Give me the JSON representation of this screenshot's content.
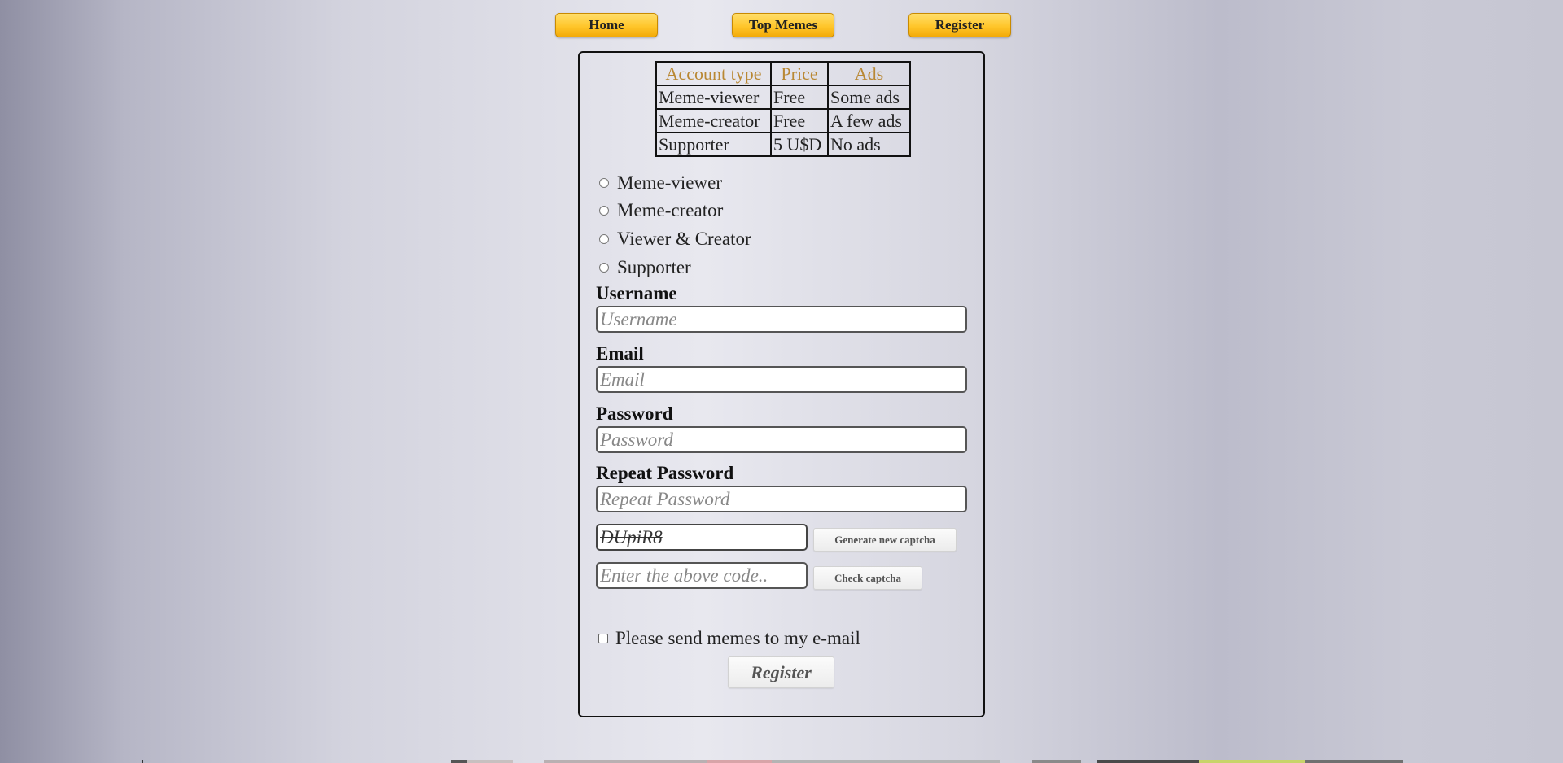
{
  "nav": {
    "home": "Home",
    "top_memes": "Top Memes",
    "register": "Register"
  },
  "account_table": {
    "headers": [
      "Account type",
      "Price",
      "Ads"
    ],
    "rows": [
      [
        "Meme-viewer",
        "Free",
        "Some ads"
      ],
      [
        "Meme-creator",
        "Free",
        "A few ads"
      ],
      [
        "Supporter",
        "5 U$D",
        "No ads"
      ]
    ]
  },
  "account_options": [
    "Meme-viewer",
    "Meme-creator",
    "Viewer & Creator",
    "Supporter"
  ],
  "form": {
    "username": {
      "label": "Username",
      "placeholder": "Username"
    },
    "email": {
      "label": "Email",
      "placeholder": "Email"
    },
    "password": {
      "label": "Password",
      "placeholder": "Password"
    },
    "repeat_password": {
      "label": "Repeat Password",
      "placeholder": "Repeat Password"
    },
    "captcha_code": "DUpiR8",
    "captcha_placeholder": "Enter the above code..",
    "generate_captcha": "Generate new captcha",
    "check_captcha": "Check captcha",
    "newsletter_label": "Please send memes to my e-mail",
    "submit": "Register"
  },
  "colors": {
    "nav_button": "#ffc62b",
    "table_header_text": "#b98834",
    "panel_border": "#111111"
  }
}
